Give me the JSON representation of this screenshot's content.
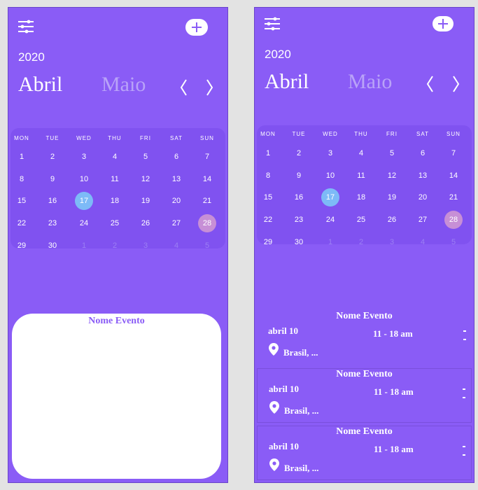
{
  "calendar": {
    "year": "2020",
    "current_month": "Abril",
    "next_month": "Maio",
    "weekdays": [
      "MON",
      "TUE",
      "WED",
      "THU",
      "FRI",
      "SAT",
      "SUN"
    ],
    "weeks": [
      [
        "1",
        "2",
        "3",
        "4",
        "5",
        "6",
        "7"
      ],
      [
        "8",
        "9",
        "10",
        "11",
        "12",
        "13",
        "14"
      ],
      [
        "15",
        "16",
        "17",
        "18",
        "19",
        "20",
        "21"
      ],
      [
        "22",
        "23",
        "24",
        "25",
        "26",
        "27",
        "28"
      ],
      [
        "29",
        "30",
        "1",
        "2",
        "3",
        "4",
        "5"
      ]
    ],
    "today": "17",
    "selected": "28"
  },
  "left_screen": {
    "event_card": {
      "title": "Nome Evento"
    }
  },
  "right_screen": {
    "events": [
      {
        "title": "Nome Evento",
        "date": "abril 10",
        "time": "11 - 18 am",
        "location": "Brasil, ..."
      },
      {
        "title": "Nome Evento",
        "date": "abril 10",
        "time": "11 - 18 am",
        "location": "Brasil, ..."
      },
      {
        "title": "Nome Evento",
        "date": "abril 10",
        "time": "11 - 18 am",
        "location": "Brasil, ..."
      }
    ]
  },
  "colors": {
    "background": "#8a5cf6",
    "calendar_panel": "#8052f0",
    "today_circle": "#7dbaf7",
    "selected_circle": "#c78fd6",
    "muted_text": "#b9a3f8"
  },
  "icons": [
    "filter-sliders-icon",
    "add-icon",
    "chevron-left-icon",
    "chevron-right-icon",
    "location-pin-icon",
    "more-options-icon"
  ]
}
